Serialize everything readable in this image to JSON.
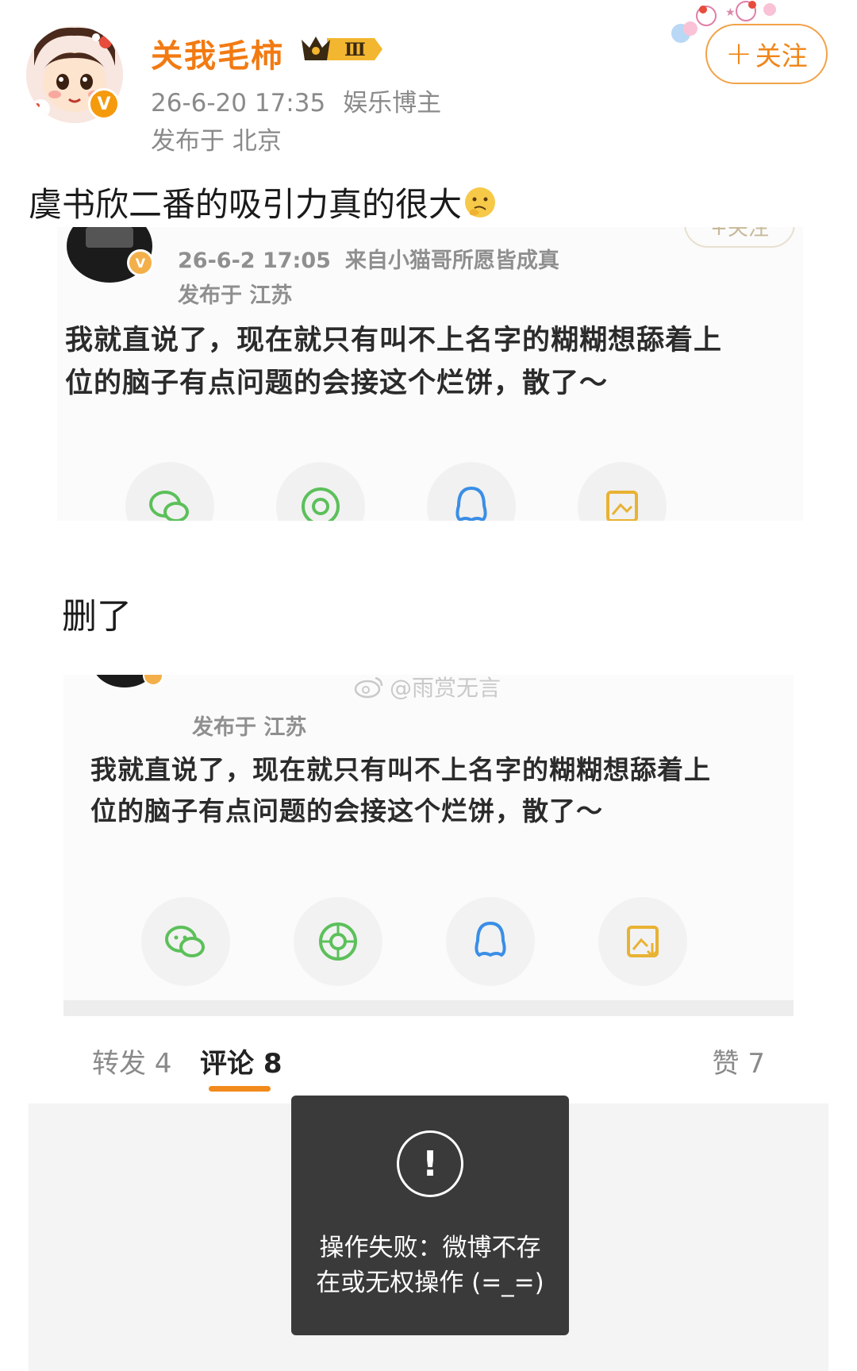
{
  "header": {
    "author_name": "关我毛柿",
    "rank_badge": "Ⅲ",
    "timestamp": "26-6-20 17:35",
    "category": "娱乐博主",
    "location": "发布于 北京",
    "verified_mark": "V",
    "follow_button": "关注"
  },
  "post": {
    "text": "虞书欣二番的吸引力真的很大"
  },
  "screenshot1": {
    "follow_label": "+关注",
    "timestamp": "26-6-2 17:05",
    "source": "来自小猫哥所愿皆成真",
    "location": "发布于 江苏",
    "body_line1": "我就直说了，现在就只有叫不上名字的糊糊想舔着上",
    "body_line2": "位的脑子有点问题的会接这个烂饼，散了～",
    "verified_mark": "V"
  },
  "deleted_label": "删了",
  "watermark": "@雨赏无言",
  "screenshot2": {
    "location": "发布于 江苏",
    "body_line1": "我就直说了，现在就只有叫不上名字的糊糊想舔着上",
    "body_line2": "位的脑子有点问题的会接这个烂饼，散了～"
  },
  "tabs": {
    "repost": "转发 4",
    "comments": "评论 8",
    "likes": "赞 7"
  },
  "toast": {
    "icon": "!",
    "line1": "操作失败：微博不存",
    "line2": "在或无权操作 (=_=)"
  },
  "colors": {
    "accent": "#f27a12",
    "verified": "#f59a0d",
    "toast_bg": "#3a3a3a"
  }
}
